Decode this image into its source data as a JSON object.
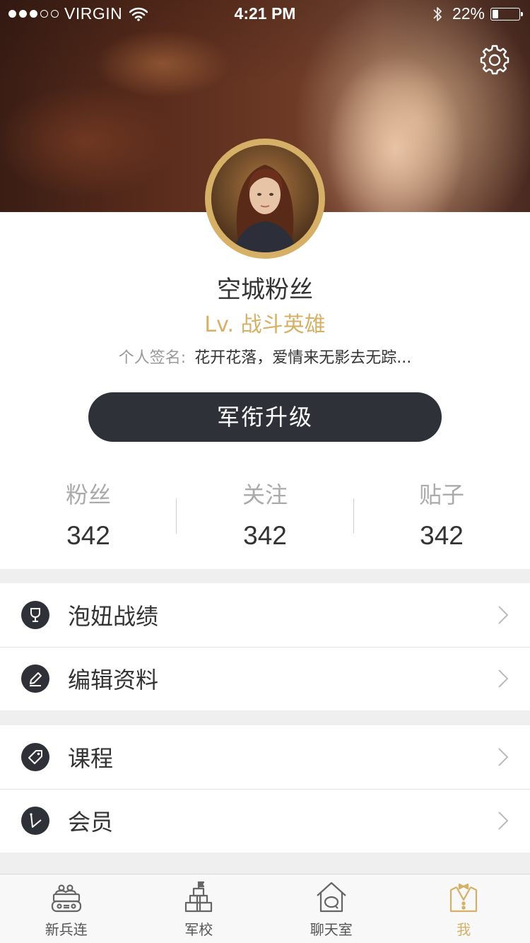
{
  "status_bar": {
    "signal_dots": [
      true,
      true,
      true,
      false,
      false
    ],
    "carrier": "VIRGIN",
    "time": "4:21 PM",
    "battery_text": "22%",
    "battery_level": 0.22
  },
  "profile": {
    "username": "空城粉丝",
    "level": "Lv. 战斗英雄",
    "signature_label": "个人签名:",
    "signature_text": "花开花落，爱情来无影去无踪...",
    "upgrade_button": "军衔升级"
  },
  "stats": [
    {
      "label": "粉丝",
      "value": "342"
    },
    {
      "label": "关注",
      "value": "342"
    },
    {
      "label": "贴子",
      "value": "342"
    }
  ],
  "menu_groups": [
    [
      {
        "label": "泡妞战绩",
        "icon": "trophy-icon"
      },
      {
        "label": "编辑资料",
        "icon": "pencil-icon"
      }
    ],
    [
      {
        "label": "课程",
        "icon": "tag-icon"
      },
      {
        "label": "会员",
        "icon": "vip-icon"
      }
    ]
  ],
  "tabs": [
    {
      "label": "新兵连",
      "icon": "tank-icon",
      "active": false
    },
    {
      "label": "军校",
      "icon": "school-icon",
      "active": false
    },
    {
      "label": "聊天室",
      "icon": "chat-house-icon",
      "active": false
    },
    {
      "label": "我",
      "icon": "uniform-icon",
      "active": true
    }
  ],
  "colors": {
    "accent_gold": "#d6b066",
    "dark_button": "#2e3238",
    "page_background": "#efefef"
  }
}
